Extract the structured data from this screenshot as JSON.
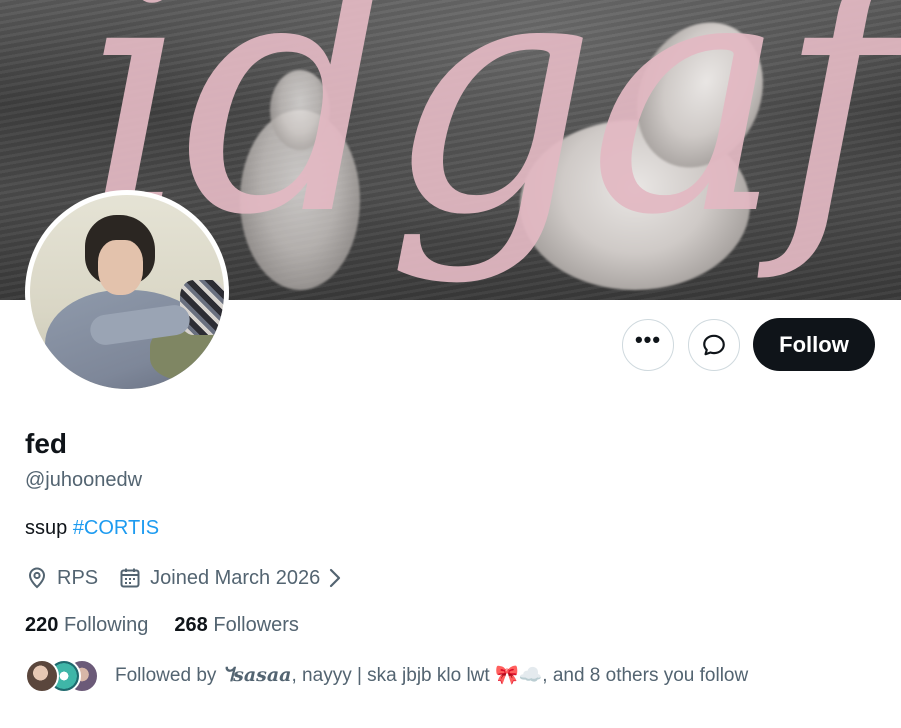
{
  "banner": {
    "text": "idgaf",
    "text_color": "#e3b9c3"
  },
  "actions": {
    "more_label": "•••",
    "follow_label": "Follow"
  },
  "profile": {
    "name": "fed",
    "handle": "@juhoonedw",
    "bio_text": "ssup ",
    "bio_hashtag": "#CORTIS",
    "location": "RPS",
    "joined": "Joined March 2026",
    "following_count": "220",
    "following_label": "Following",
    "followers_count": "268",
    "followers_label": "Followers"
  },
  "followed_by": {
    "prefix": "Followed by ",
    "name1": "ᖻ𝒔𝒂𝒔𝒂𝒂",
    "rest": ", nayyy | ska jbjb klo lwt 🎀☁️, and 8 others you follow"
  },
  "colors": {
    "accent": "#1d9bf0",
    "primary_text": "#0f1419",
    "secondary_text": "#536471",
    "follow_bg": "#0f1419"
  },
  "icons": {
    "more": "more-icon",
    "message": "message-icon",
    "location": "location-icon",
    "calendar": "calendar-icon",
    "chevron": "chevron-right-icon"
  }
}
